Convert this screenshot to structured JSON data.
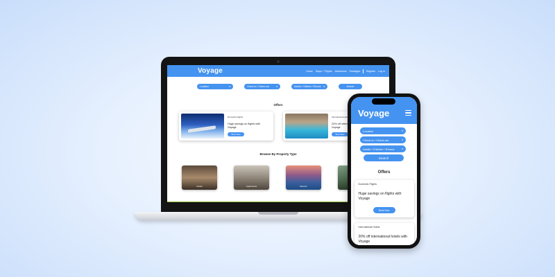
{
  "brand": {
    "name": "Voyage",
    "accent": "#4593f0"
  },
  "desktop": {
    "nav": {
      "links": [
        "Home",
        "Stays + Flights",
        "Attractions",
        "Packages"
      ],
      "auth": [
        "Register",
        "Log in"
      ]
    },
    "search": {
      "location": "Location",
      "dates": "Check-in / Check-out",
      "guests": "Adults / Children / Rooms",
      "button": "Search"
    },
    "offers_title": "Offers",
    "offers": [
      {
        "tag": "Domestic Flights",
        "text": "Huge savings on flights with Voyage",
        "button": "Book Now"
      },
      {
        "tag": "International Hotels",
        "text": "20% off international hotels with Voyage",
        "button": "Book Now"
      }
    ],
    "property_title": "Browse By Property Type",
    "properties": [
      {
        "label": "Hotels"
      },
      {
        "label": "Apartments"
      },
      {
        "label": "Resorts"
      },
      {
        "label": ""
      }
    ]
  },
  "mobile": {
    "search": {
      "location": "Location",
      "dates": "Check-in / Check-out",
      "guests": "Adults / Children / Rooms",
      "button": "Search"
    },
    "offers_title": "Offers",
    "offers": [
      {
        "tag": "Domestic Flights",
        "text": "Huge savings on flights with Voyage",
        "button": "Book Now"
      },
      {
        "tag": "International Hotels",
        "text": "20% off international hotels with Voyage"
      }
    ]
  },
  "icons": {
    "dropdown": "chevron-down-icon",
    "menu": "hamburger-menu-icon"
  }
}
